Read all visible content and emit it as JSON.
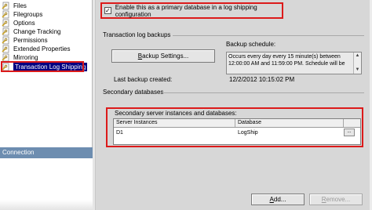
{
  "nav": {
    "items": [
      {
        "label": "Files"
      },
      {
        "label": "Filegroups"
      },
      {
        "label": "Options"
      },
      {
        "label": "Change Tracking"
      },
      {
        "label": "Permissions"
      },
      {
        "label": "Extended Properties"
      },
      {
        "label": "Mirroring"
      },
      {
        "label": "Transaction Log Shipping",
        "selected": true
      }
    ],
    "connection_label": "Connection"
  },
  "log_shipping": {
    "enable_checked": true,
    "enable_label": "Enable this as a primary database in a log shipping configuration",
    "backups_section": "Transaction log backups",
    "backup_settings_button": "Backup Settings...",
    "backup_settings_mnemonic": "B",
    "backup_settings_rest": "ackup Settings...",
    "backup_schedule_label": "Backup schedule:",
    "backup_schedule_text": "Occurs every day every 15 minute(s) between 12:00:00 AM and 11:59:00 PM. Schedule will be",
    "last_backup_label": "Last backup created:",
    "last_backup_value": "12/2/2012 10:15:02 PM",
    "secondary_section": "Secondary databases",
    "grid_caption": "Secondary server instances and databases:",
    "grid_columns": [
      "Server Instances",
      "Database"
    ],
    "grid_rows": [
      {
        "server": "D1",
        "database": "LogShip"
      }
    ],
    "ellipsis": "...",
    "add_button": "Add...",
    "add_mnemonic": "A",
    "add_rest": "dd...",
    "remove_button": "Remove...",
    "remove_mnemonic": "R",
    "remove_rest": "emove..."
  },
  "colors": {
    "highlight_border": "#dc1a1a",
    "selection": "#000080",
    "connection_header": "#6d8db0",
    "pane_background": "#d7d7d7"
  },
  "icons": {
    "nav_item": "page-wrench-icon",
    "checkbox_check": "✓",
    "scroll_up": "▲",
    "scroll_down": "▼"
  }
}
